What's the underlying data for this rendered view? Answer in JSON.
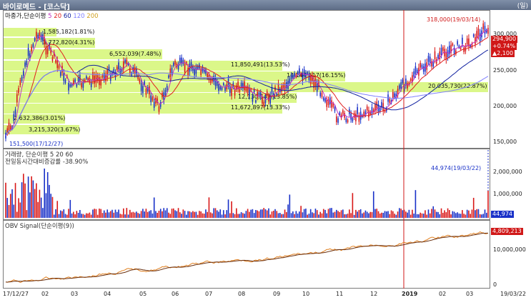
{
  "window": {
    "title": "바이로메드 - [코스닥]",
    "unit_label": "(일)"
  },
  "price_pane": {
    "header": {
      "label": "마종가,단순이평",
      "p5": "5",
      "p20": "20",
      "p60": "60",
      "p120": "120",
      "p200": "200"
    },
    "y_ticks": [
      "300,000",
      "250,000",
      "200,000",
      "150,000"
    ],
    "last_price": "294,900",
    "change_pct": "+0.74%",
    "change_abs": "▲2,100",
    "high_label": "318,000(19/03/14)",
    "low_label": "151,500(17/12/27)",
    "volume_profile": [
      "1,585,182(1.81%)",
      "3,772,820(4.31%)",
      "6,552,039(7.48%)",
      "11,850,491(13.53%)",
      "14,144,517(16.15%)",
      "12,130,543(13.85%)",
      "20,035,730(22.87%)",
      "11,672,897(13.33%)",
      "2,632,386(3.01%)",
      "3,215,320(3.67%)"
    ]
  },
  "volume_pane": {
    "header1": "거래량, 단순이평 5 20 60",
    "header2": "전일동시간대비증감률 -38.90%",
    "y_ticks": [
      "2,000,000",
      "1,000,000"
    ],
    "last_value": "44,974",
    "annotation": "44,974(19/03/22)"
  },
  "obv_pane": {
    "header": "OBV Signal(단순이평(9))",
    "y_ticks": [
      "10,000,000",
      "0"
    ],
    "last_value": "4,809,213"
  },
  "x_labels": [
    "17/12/27",
    "02",
    "03",
    "04",
    "05",
    "06",
    "07",
    "08",
    "09",
    "10",
    "11",
    "12",
    "2019",
    "02",
    "03",
    "19/03/22"
  ],
  "colors": {
    "up": "#d81818",
    "down": "#1830c8",
    "band": "#bef028",
    "ma5": "#c030c0",
    "ma20": "#e02020",
    "ma60": "#1020a0"
  }
}
